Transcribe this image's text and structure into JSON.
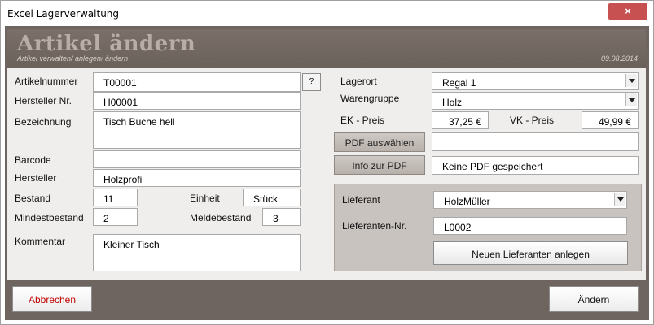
{
  "window": {
    "title": "Excel Lagerverwaltung",
    "close_glyph": "×"
  },
  "header": {
    "title": "Artikel ändern",
    "subtitle": "Artikel verwalten/ anlegen/ ändern",
    "date": "09.08.2014"
  },
  "left": {
    "artikelnummer": {
      "label": "Artikelnummer",
      "value": "T00001",
      "help_label": "?"
    },
    "hersteller_nr": {
      "label": "Hersteller Nr.",
      "value": "H00001"
    },
    "bezeichnung": {
      "label": "Bezeichnung",
      "value": "Tisch Buche hell"
    },
    "barcode": {
      "label": "Barcode",
      "value": ""
    },
    "hersteller": {
      "label": "Hersteller",
      "value": "Holzprofi"
    },
    "bestand": {
      "label": "Bestand",
      "value": "11"
    },
    "einheit": {
      "label": "Einheit",
      "value": "Stück"
    },
    "mindestbestand": {
      "label": "Mindestbestand",
      "value": "2"
    },
    "meldebestand": {
      "label": "Meldebestand",
      "value": "3"
    },
    "kommentar": {
      "label": "Kommentar",
      "value": "Kleiner Tisch"
    }
  },
  "right": {
    "lagerort": {
      "label": "Lagerort",
      "value": "Regal 1"
    },
    "warengruppe": {
      "label": "Warengruppe",
      "value": "Holz"
    },
    "ek_preis": {
      "label": "EK - Preis",
      "value": "37,25 €"
    },
    "vk_preis": {
      "label": "VK - Preis",
      "value": "49,99 €"
    },
    "pdf_select": {
      "label": "PDF auswählen",
      "value": ""
    },
    "pdf_info": {
      "label": "Info zur PDF",
      "value": "Keine PDF gespeichert"
    }
  },
  "supplier": {
    "lieferant": {
      "label": "Lieferant",
      "value": "HolzMüller"
    },
    "lieferanten_nr": {
      "label": "Lieferanten-Nr.",
      "value": "L0002"
    },
    "new_button": "Neuen Lieferanten anlegen"
  },
  "footer": {
    "cancel": "Abbrechen",
    "submit": "Ändern"
  },
  "colors": {
    "frame": "#6f6560",
    "header_title": "#b9aea7",
    "cancel_text": "#c00000",
    "close_button": "#c75050"
  }
}
